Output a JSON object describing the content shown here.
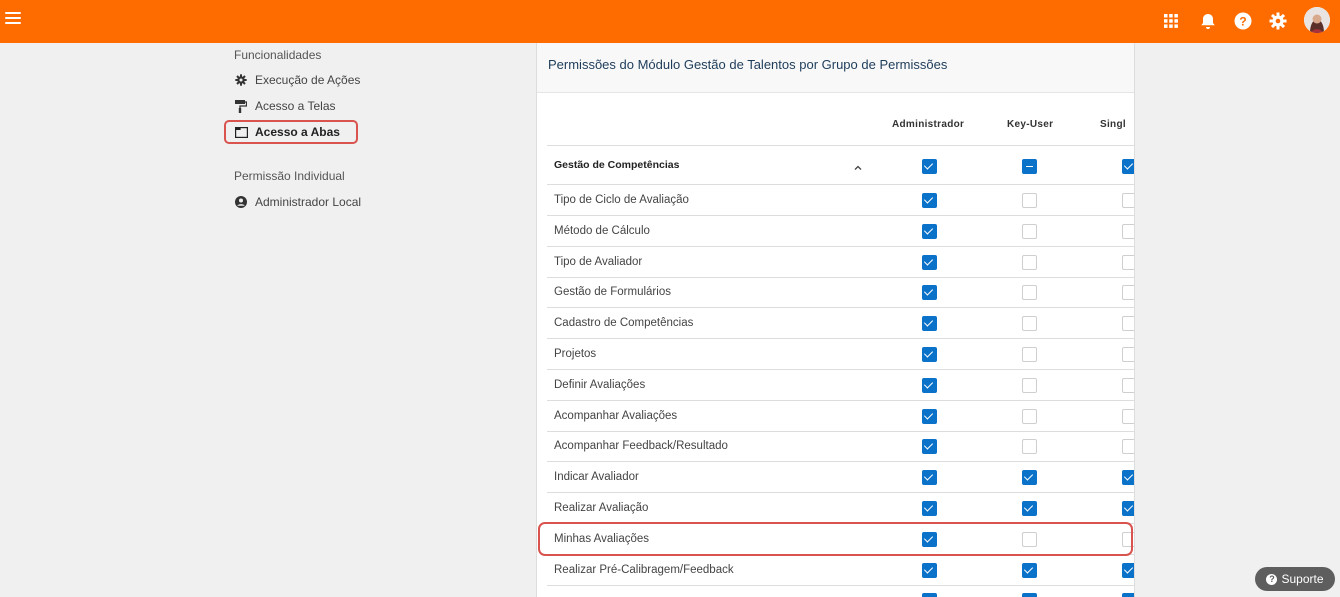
{
  "colors": {
    "topbar": "#fe6c00",
    "checkbox_on": "#0b72c9",
    "highlight": "#d9534f"
  },
  "topbar": {
    "icons": [
      "menu-icon",
      "apps-grid-icon",
      "bell-icon",
      "help-icon",
      "gear-icon",
      "avatar"
    ]
  },
  "sidebar": {
    "functionalities_title": "Funcionalidades",
    "items": [
      {
        "label": "Execução de Ações",
        "icon": "gear-icon"
      },
      {
        "label": "Acesso a Telas",
        "icon": "paint-roller-icon"
      },
      {
        "label": "Acesso a Abas",
        "icon": "tab-window-icon"
      }
    ],
    "individual_title": "Permissão Individual",
    "individual_items": [
      {
        "label": "Administrador Local",
        "icon": "user-circle-icon"
      }
    ]
  },
  "panel": {
    "title": "Permissões do Módulo Gestão de Talentos por Grupo de Permissões",
    "columns": [
      "Administrador",
      "Key-User",
      "Singl"
    ],
    "group": {
      "label": "Gestão de Competências",
      "states": [
        "on",
        "ind",
        "on"
      ]
    },
    "rows": [
      {
        "label": "Tipo de Ciclo de Avaliação",
        "states": [
          "on",
          "off",
          "off"
        ]
      },
      {
        "label": "Método de Cálculo",
        "states": [
          "on",
          "off",
          "off"
        ]
      },
      {
        "label": "Tipo de Avaliador",
        "states": [
          "on",
          "off",
          "off"
        ]
      },
      {
        "label": "Gestão de Formulários",
        "states": [
          "on",
          "off",
          "off"
        ]
      },
      {
        "label": "Cadastro de Competências",
        "states": [
          "on",
          "off",
          "off"
        ]
      },
      {
        "label": "Projetos",
        "states": [
          "on",
          "off",
          "off"
        ]
      },
      {
        "label": "Definir Avaliações",
        "states": [
          "on",
          "off",
          "off"
        ]
      },
      {
        "label": "Acompanhar Avaliações",
        "states": [
          "on",
          "off",
          "off"
        ]
      },
      {
        "label": "Acompanhar Feedback/Resultado",
        "states": [
          "on",
          "off",
          "off"
        ]
      },
      {
        "label": "Indicar Avaliador",
        "states": [
          "on",
          "on",
          "on"
        ]
      },
      {
        "label": "Realizar Avaliação",
        "states": [
          "on",
          "on",
          "on"
        ]
      },
      {
        "label": "Minhas Avaliações",
        "states": [
          "on",
          "off",
          "off"
        ]
      },
      {
        "label": "Realizar Pré-Calibragem/Feedback",
        "states": [
          "on",
          "on",
          "on"
        ]
      },
      {
        "label": "",
        "states": [
          "on",
          "on",
          "on"
        ]
      }
    ]
  },
  "support_label": "Suporte"
}
